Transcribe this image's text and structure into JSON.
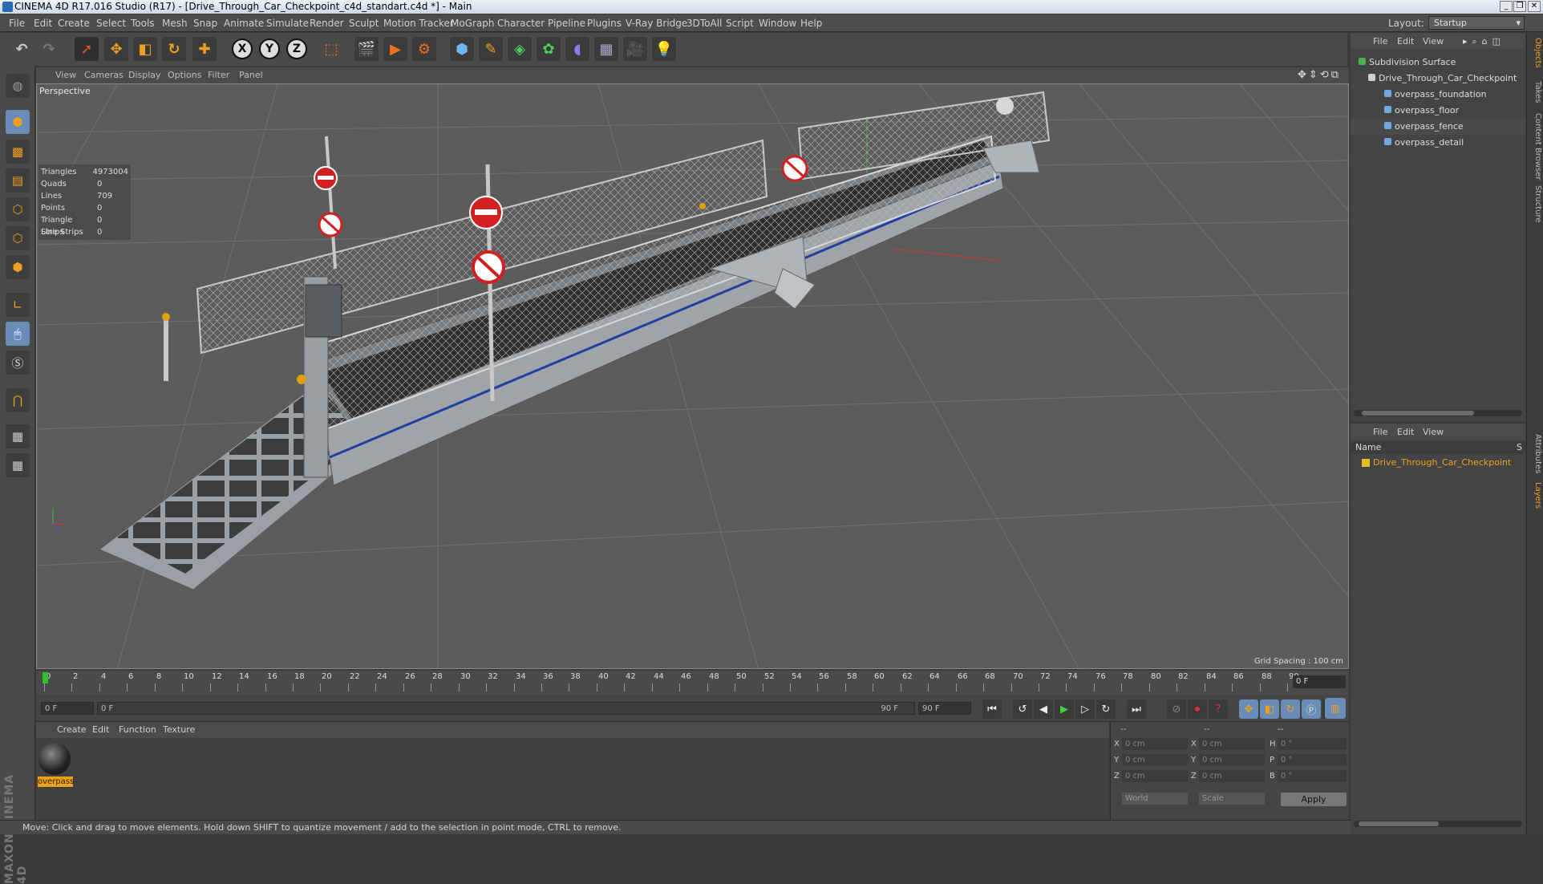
{
  "window": {
    "title": "CINEMA 4D R17.016 Studio (R17) - [Drive_Through_Car_Checkpoint_c4d_standart.c4d *] - Main",
    "buttons": [
      "_",
      "❐",
      "✕"
    ]
  },
  "menubar": {
    "items": [
      "File",
      "Edit",
      "Create",
      "Select",
      "Tools",
      "Mesh",
      "Snap",
      "Animate",
      "Simulate",
      "Render",
      "Sculpt",
      "Motion Tracker",
      "MoGraph",
      "Character",
      "Pipeline",
      "Plugins",
      "V-Ray Bridge",
      "3DToAll",
      "Script",
      "Window",
      "Help"
    ],
    "layout_label": "Layout:",
    "layout_value": "Startup"
  },
  "toolbar": {
    "icons": [
      "undo-icon",
      "redo-icon",
      "live-selection-icon",
      "move-icon",
      "scale-icon",
      "rotate-icon",
      "recent-tool-icon",
      "x-axis-icon",
      "y-axis-icon",
      "z-axis-icon",
      "coordinate-system-icon",
      "render-view-icon",
      "render-picture-viewer-icon",
      "edit-render-settings-icon",
      "cube-icon",
      "pen-icon",
      "subdivision-icon",
      "cloner-icon",
      "deformer-icon",
      "floor-icon",
      "camera-icon",
      "light-icon"
    ],
    "axis_labels": [
      "X",
      "Y",
      "Z"
    ]
  },
  "left_tools": [
    "make-editable-icon",
    "model-mode-icon",
    "texture-mode-icon",
    "workplane-icon",
    "points-mode-icon",
    "edges-mode-icon",
    "polygons-mode-icon",
    "axis-mode-icon",
    "tweak-mode-icon",
    "soft-selection-icon",
    "magnet-icon",
    "snap-enable-icon",
    "locked-workplane-icon"
  ],
  "viewport": {
    "menu": [
      "View",
      "Cameras",
      "Display",
      "Options",
      "Filter",
      "Panel"
    ],
    "label": "Perspective",
    "stats": [
      {
        "k": "Triangles",
        "v": "4973004"
      },
      {
        "k": "Quads",
        "v": "0"
      },
      {
        "k": "Lines",
        "v": "709"
      },
      {
        "k": "Points",
        "v": "0"
      },
      {
        "k": "Triangle Strips",
        "v": "0"
      },
      {
        "k": "Line Strips",
        "v": "0"
      }
    ],
    "grid_spacing": "Grid Spacing : 100 cm"
  },
  "timeline": {
    "ticks": [
      "0",
      "2",
      "4",
      "6",
      "8",
      "10",
      "12",
      "14",
      "16",
      "18",
      "20",
      "22",
      "24",
      "26",
      "28",
      "30",
      "32",
      "34",
      "36",
      "38",
      "40",
      "42",
      "44",
      "46",
      "48",
      "50",
      "52",
      "54",
      "56",
      "58",
      "60",
      "62",
      "64",
      "66",
      "68",
      "70",
      "72",
      "74",
      "76",
      "78",
      "80",
      "82",
      "84",
      "86",
      "88",
      "90"
    ],
    "current_frame": "0 F",
    "start_field": "0 F",
    "range_start": "0 F",
    "range_end": "90 F",
    "end_field": "90 F"
  },
  "material_manager": {
    "menu": [
      "Create",
      "Edit",
      "Function",
      "Texture"
    ],
    "material_name": "overpass"
  },
  "coordinates": {
    "headers": [
      "--",
      "--",
      "--"
    ],
    "rows": [
      {
        "pl": "X",
        "pv": "0 cm",
        "sl": "X",
        "sv": "0 cm",
        "rl": "H",
        "rv": "0 °"
      },
      {
        "pl": "Y",
        "pv": "0 cm",
        "sl": "Y",
        "sv": "0 cm",
        "rl": "P",
        "rv": "0 °"
      },
      {
        "pl": "Z",
        "pv": "0 cm",
        "sl": "Z",
        "sv": "0 cm",
        "rl": "B",
        "rv": "0 °"
      }
    ],
    "mode": "World",
    "scale_mode": "Scale",
    "apply": "Apply"
  },
  "object_manager": {
    "menu": [
      "File",
      "Edit",
      "View"
    ],
    "tree": [
      {
        "name": "Subdivision Surface",
        "indent": 0,
        "color": "#4caf50"
      },
      {
        "name": "Drive_Through_Car_Checkpoint",
        "indent": 1,
        "color": "#cfcfcf"
      },
      {
        "name": "overpass_foundation",
        "indent": 2,
        "color": "#6fa8dc"
      },
      {
        "name": "overpass_floor",
        "indent": 2,
        "color": "#6fa8dc"
      },
      {
        "name": "overpass_fence",
        "indent": 2,
        "color": "#6fa8dc"
      },
      {
        "name": "overpass_detail",
        "indent": 2,
        "color": "#6fa8dc"
      }
    ]
  },
  "layer_manager": {
    "menu": [
      "File",
      "Edit",
      "View"
    ],
    "header_name": "Name",
    "header_s": "S",
    "layer_name": "Drive_Through_Car_Checkpoint"
  },
  "side_tabs_top": [
    "Objects",
    "Takes",
    "Content Browser",
    "Structure"
  ],
  "side_tabs_bottom": [
    "Attributes",
    "Layers"
  ],
  "statusbar": {
    "text": "Move: Click and drag to move elements. Hold down SHIFT to quantize movement / add to the selection in point mode, CTRL to remove."
  },
  "colors": {
    "accent": "#f0a020",
    "viewport_bg": "#5c5c5c",
    "panel_bg": "#444444"
  }
}
